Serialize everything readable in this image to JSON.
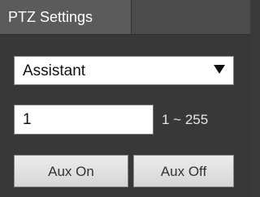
{
  "panel": {
    "title": "PTZ Settings"
  },
  "function_select": {
    "selected": "Assistant"
  },
  "aux_number": {
    "value": "1",
    "range_text": "1 ~ 255"
  },
  "buttons": {
    "aux_on": "Aux On",
    "aux_off": "Aux Off"
  },
  "icons": {
    "select_arrow": "triangle-down-icon"
  },
  "colors": {
    "background": "#383838",
    "header_tab": "#5b5b5b",
    "text_light": "#ffffff"
  }
}
